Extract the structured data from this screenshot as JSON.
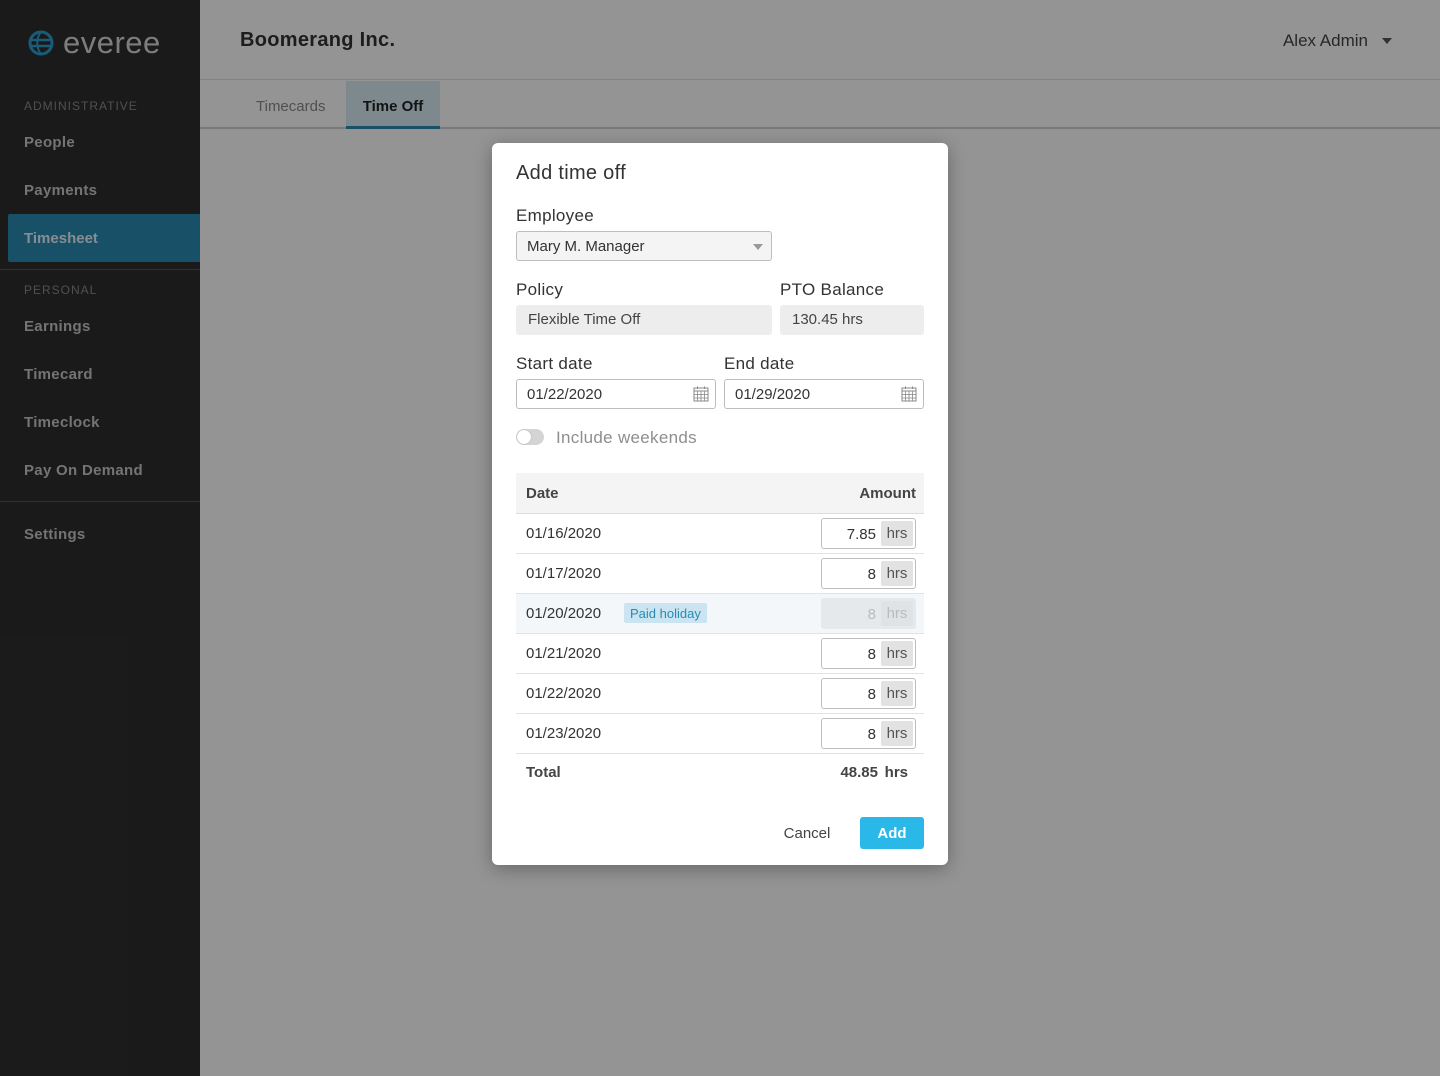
{
  "app": {
    "logo_text": "everee",
    "company": "Boomerang Inc.",
    "user_name": "Alex Admin"
  },
  "sidebar": {
    "administrative_label": "ADMINISTRATIVE",
    "personal_label": "PERSONAL",
    "admin_items": [
      {
        "label": "People"
      },
      {
        "label": "Payments"
      },
      {
        "label": "Timesheet",
        "active": true
      }
    ],
    "personal_items": [
      {
        "label": "Earnings"
      },
      {
        "label": "Timecard"
      },
      {
        "label": "Timeclock"
      },
      {
        "label": "Pay On Demand"
      }
    ],
    "settings_label": "Settings"
  },
  "tabs": [
    {
      "label": "Timecards"
    },
    {
      "label": "Time Off",
      "active": true
    }
  ],
  "modal": {
    "title": "Add time off",
    "employee_label": "Employee",
    "employee_value": "Mary M. Manager",
    "policy_label": "Policy",
    "policy_value": "Flexible Time Off",
    "pto_label": "PTO Balance",
    "pto_value": "130.45 hrs",
    "start_label": "Start date",
    "start_value": "01/22/2020",
    "end_label": "End date",
    "end_value": "01/29/2020",
    "weekends_label": "Include weekends",
    "weekends_on": false,
    "table": {
      "col_date": "Date",
      "col_amount": "Amount",
      "unit": "hrs",
      "rows": [
        {
          "date": "01/16/2020",
          "amount": "7.85"
        },
        {
          "date": "01/17/2020",
          "amount": "8"
        },
        {
          "date": "01/20/2020",
          "amount": "8",
          "badge": "Paid holiday"
        },
        {
          "date": "01/21/2020",
          "amount": "8"
        },
        {
          "date": "01/22/2020",
          "amount": "8"
        },
        {
          "date": "01/23/2020",
          "amount": "8"
        }
      ],
      "total_label": "Total",
      "total_value": "48.85",
      "total_unit": "hrs"
    },
    "cancel_label": "Cancel",
    "add_label": "Add"
  },
  "colors": {
    "sidebar_bg": "#2e2e2e",
    "accent": "#2a8bb1",
    "primary_button": "#29b8e8"
  }
}
